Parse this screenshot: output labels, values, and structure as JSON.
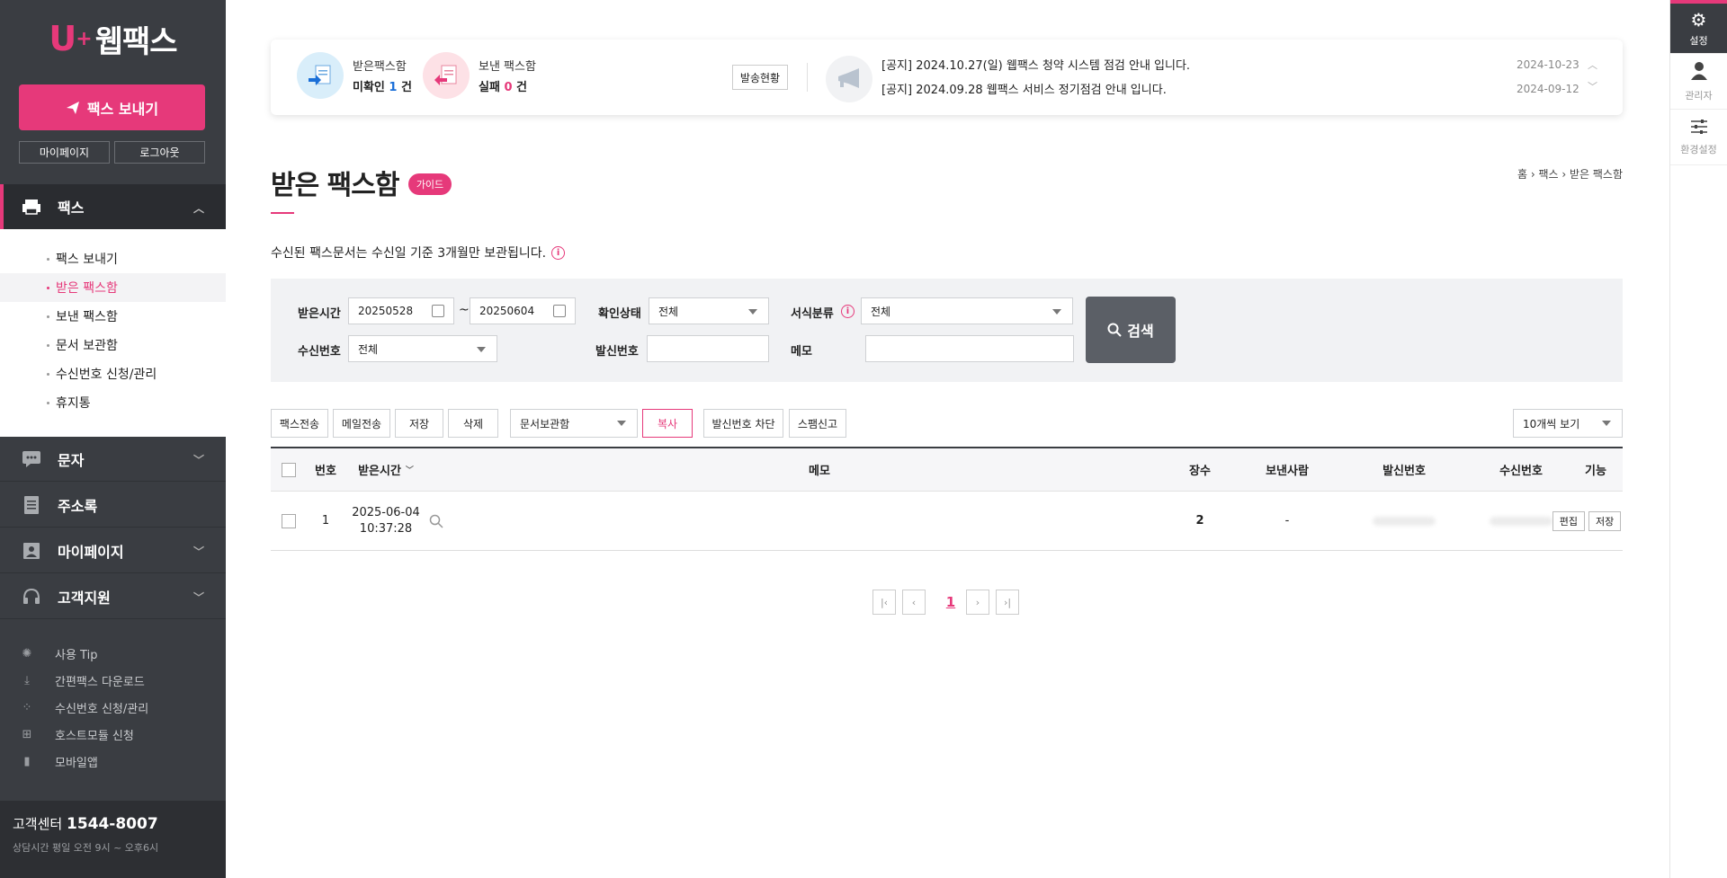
{
  "brand": {
    "name": "웹팩스"
  },
  "sidebar": {
    "send_fax": "팩스 보내기",
    "mypage": "마이페이지",
    "logout": "로그아웃",
    "fax_menu": "팩스",
    "fax_items": [
      "팩스 보내기",
      "받은 팩스함",
      "보낸 팩스함",
      "문서 보관함",
      "수신번호 신청/관리",
      "휴지통"
    ],
    "menus": [
      "문자",
      "주소록",
      "마이페이지",
      "고객지원"
    ],
    "extras": [
      "사용 Tip",
      "간편팩스 다운로드",
      "수신번호 신청/관리",
      "호스트모듈 신청",
      "모바일앱"
    ],
    "cs_label": "고객센터",
    "cs_phone": "1544-8007",
    "cs_hours": "상담시간 평일 오전 9시 ~ 오후6시"
  },
  "rightbar": {
    "settings": "설정",
    "admin": "관리자",
    "prefs": "환경설정"
  },
  "notice": {
    "received_label": "받은팩스함",
    "unread_prefix": "미확인",
    "unread_count": "1",
    "unit": "건",
    "sent_label": "보낸 팩스함",
    "failed_prefix": "실패",
    "failed_count": "0",
    "status_btn": "발송현황",
    "items": [
      {
        "text": "[공지] 2024.10.27(일) 웹팩스 청약 시스템 점검 안내 입니다.",
        "date": "2024-10-23"
      },
      {
        "text": "[공지] 2024.09.28 웹팩스 서비스 정기점검 안내 입니다.",
        "date": "2024-09-12"
      }
    ]
  },
  "page": {
    "title": "받은 팩스함",
    "guide": "가이드",
    "breadcrumb": [
      "홈",
      "팩스",
      "받은 팩스함"
    ],
    "info": "수신된 팩스문서는 수신일 기준 3개월만 보관됩니다."
  },
  "search": {
    "received_time_label": "받은시간",
    "date_from": "20250528",
    "date_to": "20250604",
    "confirm_label": "확인상태",
    "confirm_value": "전체",
    "category_label": "서식분류",
    "category_value": "전체",
    "recv_no_label": "수신번호",
    "recv_no_value": "전체",
    "sender_no_label": "발신번호",
    "memo_label": "메모",
    "button": "검색"
  },
  "toolbar": {
    "fax_forward": "팩스전송",
    "mail_forward": "메일전송",
    "save": "저장",
    "delete": "삭제",
    "doc_box": "문서보관함",
    "copy": "복사",
    "block": "발신번호 차단",
    "spam": "스팸신고",
    "page_size": "10개씩 보기"
  },
  "table": {
    "headers": [
      "번호",
      "받은시간",
      "메모",
      "장수",
      "보낸사람",
      "발신번호",
      "수신번호",
      "기능"
    ],
    "rows": [
      {
        "no": "1",
        "date": "2025-06-04",
        "time": "10:37:28",
        "pages": "2",
        "sender": "-",
        "edit": "편집",
        "save": "저장"
      }
    ]
  },
  "pagination": {
    "current": "1"
  }
}
